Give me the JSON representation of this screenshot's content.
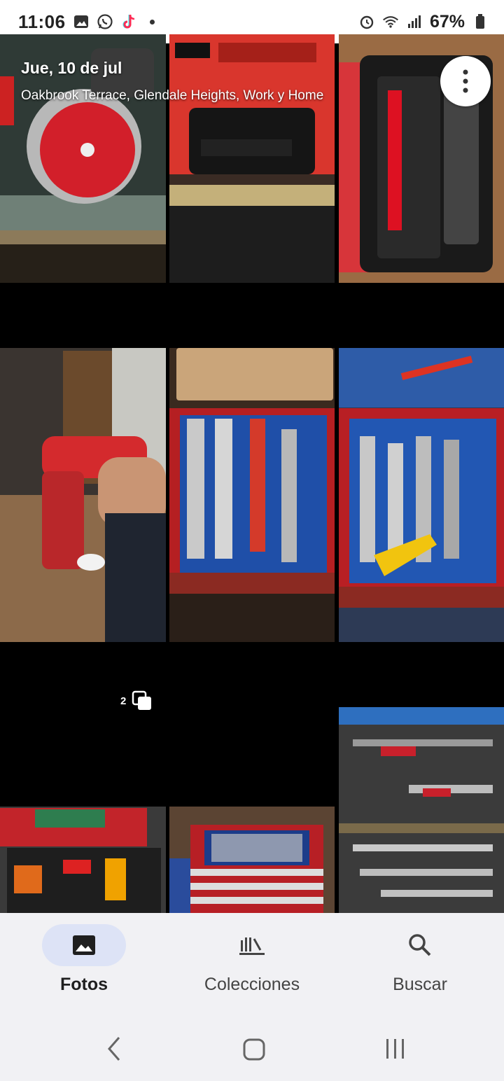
{
  "status_bar": {
    "time": "11:06",
    "battery": "67%",
    "left_icons": [
      "gallery-icon",
      "whatsapp-icon",
      "tiktok-icon",
      "notification-dot"
    ],
    "right_icons": [
      "alarm-icon",
      "wifi-icon",
      "signal-icon",
      "battery-icon"
    ]
  },
  "header": {
    "date": "Jue, 10 de jul",
    "location": "Oakbrook Terrace, Glendale Heights, Work y Home"
  },
  "grid": {
    "photos": [
      {
        "subject": "circular saw"
      },
      {
        "subject": "M18 Forge battery box"
      },
      {
        "subject": "M18 HD12.0 battery"
      },
      {
        "subject": "heat gun in hand"
      },
      {
        "subject": "pipe wrenches in drawer"
      },
      {
        "subject": "adjustable wrenches in drawer"
      },
      {
        "subject": "Mamamela Way tool chest",
        "stack_count": "2"
      },
      {
        "subject": "wrench set in red cabinet"
      },
      {
        "subject": "clamps in drawer"
      }
    ]
  },
  "bottom_nav": {
    "items": [
      {
        "label": "Fotos",
        "icon": "photos-icon",
        "active": true
      },
      {
        "label": "Colecciones",
        "icon": "collections-icon",
        "active": false
      },
      {
        "label": "Buscar",
        "icon": "search-icon",
        "active": false
      }
    ]
  },
  "system_nav": [
    "back-icon",
    "home-icon",
    "recents-icon"
  ],
  "colors": {
    "accent_pill": "#dde3f6",
    "nav_bg": "#f1f1f4",
    "milwaukee_red": "#c8202b"
  }
}
